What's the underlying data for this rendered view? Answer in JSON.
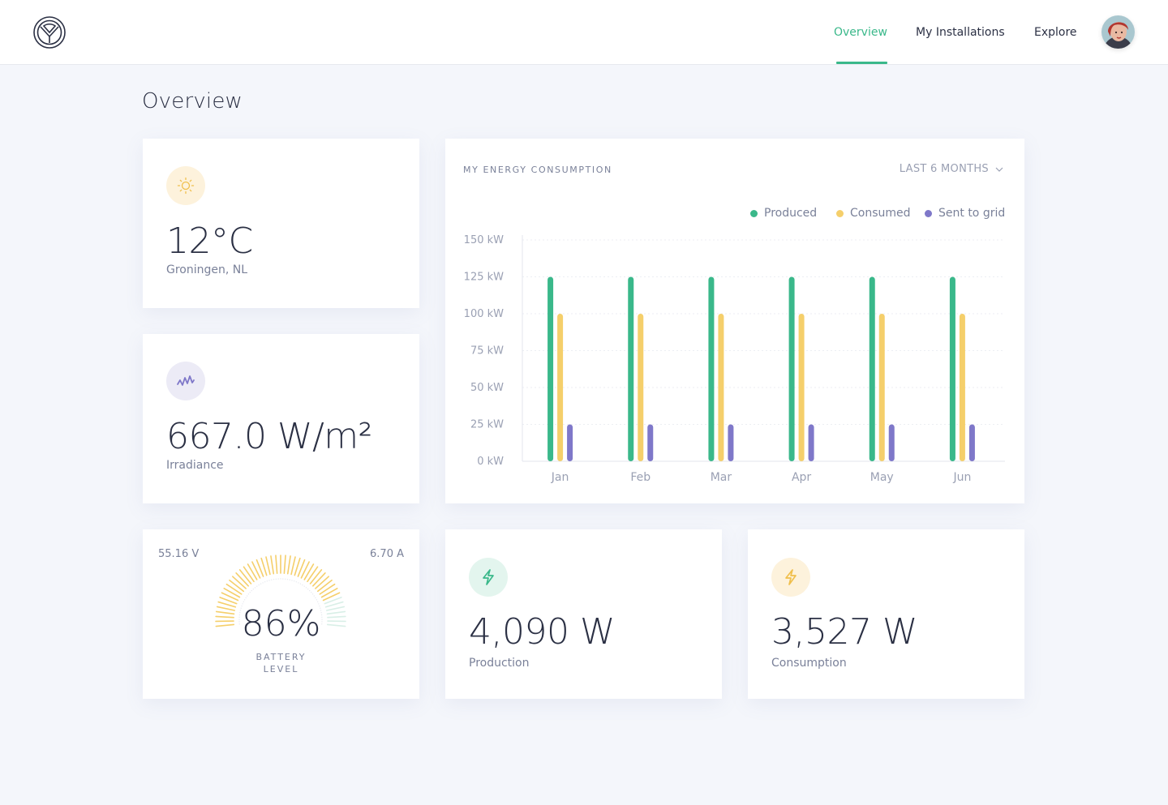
{
  "nav": {
    "overview": "Overview",
    "installations": "My Installations",
    "explore": "Explore",
    "accent": "#3ab88a"
  },
  "page": {
    "title": "Overview"
  },
  "weather": {
    "temperature": "12°C",
    "location": "Groningen, NL",
    "icon": "sun-icon"
  },
  "irradiance": {
    "value": "667.0 W/m²",
    "label": "Irradiance",
    "icon": "waveform-icon"
  },
  "battery": {
    "voltage": "55.16 V",
    "current": "6.70 A",
    "percent": "86%",
    "level": 0.86,
    "label_line1": "BATTERY",
    "label_line2": "LEVEL"
  },
  "production": {
    "value": "4,090 W",
    "label": "Production",
    "icon": "lightning-icon"
  },
  "consumption": {
    "value": "3,527 W",
    "label": "Consumption",
    "icon": "lightning-icon"
  },
  "chart": {
    "title": "MY ENERGY CONSUMPTION",
    "range": "LAST 6 MONTHS"
  },
  "chart_data": {
    "type": "bar",
    "categories": [
      "Jan",
      "Feb",
      "Mar",
      "Apr",
      "May",
      "Jun"
    ],
    "series": [
      {
        "name": "Produced",
        "color": "#3ab88a",
        "values": [
          125,
          125,
          125,
          125,
          125,
          125
        ]
      },
      {
        "name": "Consumed",
        "color": "#f5cf6b",
        "values": [
          100,
          100,
          100,
          100,
          100,
          100
        ]
      },
      {
        "name": "Sent to grid",
        "color": "#7f78c9",
        "values": [
          25,
          25,
          25,
          25,
          25,
          25
        ]
      }
    ],
    "yticks": [
      "150 kW",
      "125 kW",
      "100 kW",
      "75 kW",
      "50 kW",
      "25 kW",
      "0 kW"
    ],
    "ylim": [
      0,
      150
    ],
    "legend_position": "top-right",
    "grid": true
  }
}
